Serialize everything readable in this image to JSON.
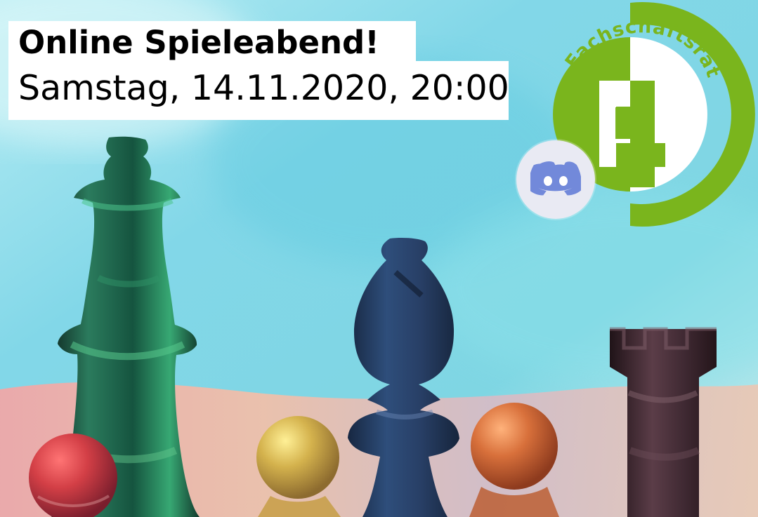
{
  "poster": {
    "title": "Online Spieleabend!",
    "date_time": "Samstag, 14.11.2020, 20:00"
  },
  "logo": {
    "number": "4",
    "text": "Fachschaftsrat",
    "brand_color": "#7ab51d"
  },
  "icons": {
    "discord": "discord-icon",
    "queen": "chess-queen-icon",
    "bishop": "chess-bishop-icon",
    "rook": "chess-rook-icon",
    "pawn": "chess-pawn-icon"
  },
  "colors": {
    "sky_blue": "#8fd8e6",
    "board_pink": "#e7a6ad",
    "queen_green": "#1c5a45",
    "bishop_blue": "#243c68",
    "rook_purple": "#3c2530",
    "pawn_red": "#cb3c3d",
    "pawn_yellow": "#d9b24a",
    "pawn_orange": "#d8723b",
    "discord_blurple": "#7289da"
  }
}
